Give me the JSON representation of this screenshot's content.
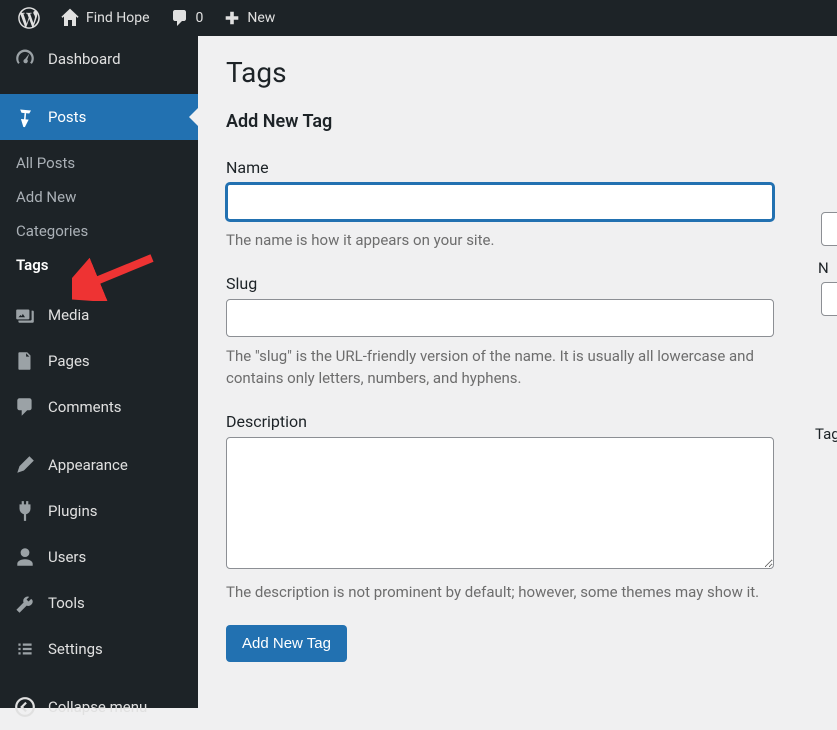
{
  "adminbar": {
    "site_name": "Find Hope",
    "comments_count": "0",
    "new_label": "New"
  },
  "sidebar": {
    "dashboard": "Dashboard",
    "posts": "Posts",
    "posts_sub": {
      "all": "All Posts",
      "add": "Add New",
      "categories": "Categories",
      "tags": "Tags"
    },
    "media": "Media",
    "pages": "Pages",
    "comments": "Comments",
    "appearance": "Appearance",
    "plugins": "Plugins",
    "users": "Users",
    "tools": "Tools",
    "settings": "Settings",
    "collapse": "Collapse menu"
  },
  "page": {
    "title": "Tags",
    "form_title": "Add New Tag",
    "name_label": "Name",
    "name_help": "The name is how it appears on your site.",
    "slug_label": "Slug",
    "slug_help": "The \"slug\" is the URL-friendly version of the name. It is usually all lowercase and contains only letters, numbers, and hyphens.",
    "desc_label": "Description",
    "desc_help": "The description is not prominent by default; however, some themes may show it.",
    "submit": "Add New Tag"
  },
  "right": {
    "n": "N",
    "tag": "Tag"
  }
}
